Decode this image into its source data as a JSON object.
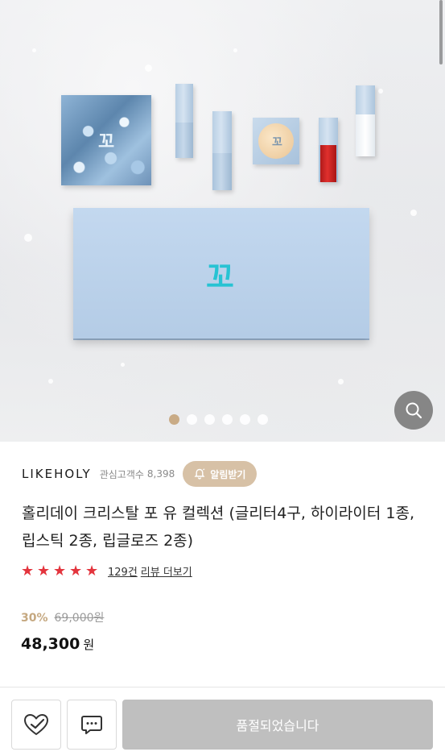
{
  "hero": {
    "carousel": {
      "total": 6,
      "active_index": 0
    }
  },
  "product": {
    "brand": "LIKEHOLY",
    "fans_label": "관심고객수",
    "fans_count": "8,398",
    "alarm_label": "알림받기",
    "title": "홀리데이 크리스탈 포 유 컬렉션 (글리터4구, 하이라이터 1종, 립스틱 2종, 립글로즈 2종)",
    "rating": {
      "stars": 5,
      "review_count": "129건",
      "review_link": "리뷰 더보기"
    },
    "price": {
      "discount": "30%",
      "original": "69,000",
      "original_unit": "원",
      "final": "48,300",
      "final_unit": "원"
    }
  },
  "bottom_bar": {
    "soldout_label": "품절되었습니다"
  },
  "colors": {
    "accent": "#d7c1a6",
    "discount": "#c5a880",
    "star": "#e3343d",
    "soldout": "#bfbfbf"
  },
  "icons": [
    "search-icon",
    "bell-icon",
    "star-icon",
    "heart-icon",
    "chat-icon"
  ]
}
